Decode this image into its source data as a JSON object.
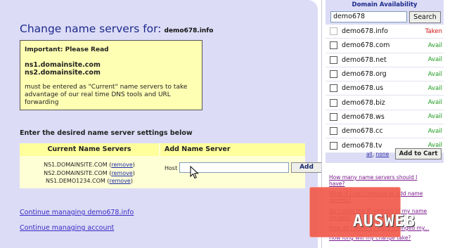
{
  "main": {
    "title": "Change name servers for:",
    "domain": "demo678.info",
    "notice": {
      "heading": "Important: Please Read",
      "ns1": "ns1.domainsite.com",
      "ns2": "ns2.domainsite.com",
      "message": "must be entered as \"Current\" name servers to take advantage of our real time DNS tools and URL forwarding"
    },
    "section_label": "Enter the desired name server settings below",
    "table": {
      "col_current": "Current Name Servers",
      "col_add": "Add Name Server",
      "current": [
        {
          "name": "NS1.DOMAINSITE.COM",
          "remove": "remove"
        },
        {
          "name": "NS2.DOMAINSITE.COM",
          "remove": "remove"
        },
        {
          "name": "NS1.DEMO1234.COM",
          "remove": "remove"
        }
      ],
      "host_label": "Host :",
      "host_value": "",
      "add_label": "Add"
    },
    "links": {
      "continue_domain": "Continue managing demo678.info",
      "continue_account": "Continue managing account"
    }
  },
  "sidebar": {
    "title": "Domain Availability",
    "search_value": "demo678",
    "search_label": "Search",
    "results": [
      {
        "name": "demo678.info",
        "status": "Taken"
      },
      {
        "name": "demo678.com",
        "status": "Avail"
      },
      {
        "name": "demo678.net",
        "status": "Avail"
      },
      {
        "name": "demo678.org",
        "status": "Avail"
      },
      {
        "name": "demo678.us",
        "status": "Avail"
      },
      {
        "name": "demo678.biz",
        "status": "Avail"
      },
      {
        "name": "demo678.ws",
        "status": "Avail"
      },
      {
        "name": "demo678.cc",
        "status": "Avail"
      },
      {
        "name": "demo678.tv",
        "status": "Avail"
      }
    ],
    "select_all": "all",
    "select_sep": ",",
    "select_none": "none",
    "add_to_cart": "Add to Cart",
    "faq": [
      "How many name servers should I have?",
      "What if I can't remove or add name servers?",
      "Do I need the IP address of my name servers?",
      "How do I know if I have changed my...",
      "How long will my change take?"
    ]
  },
  "logo_text": "AUSWEB",
  "colors": {
    "panel": "#dcdcf6",
    "title": "#1c2a8c",
    "avail": "#1f9a1f",
    "taken": "#d01010",
    "logo": "#f05a4a"
  },
  "icons": [
    "mouse-pointer-icon",
    "checkbox-icon"
  ]
}
